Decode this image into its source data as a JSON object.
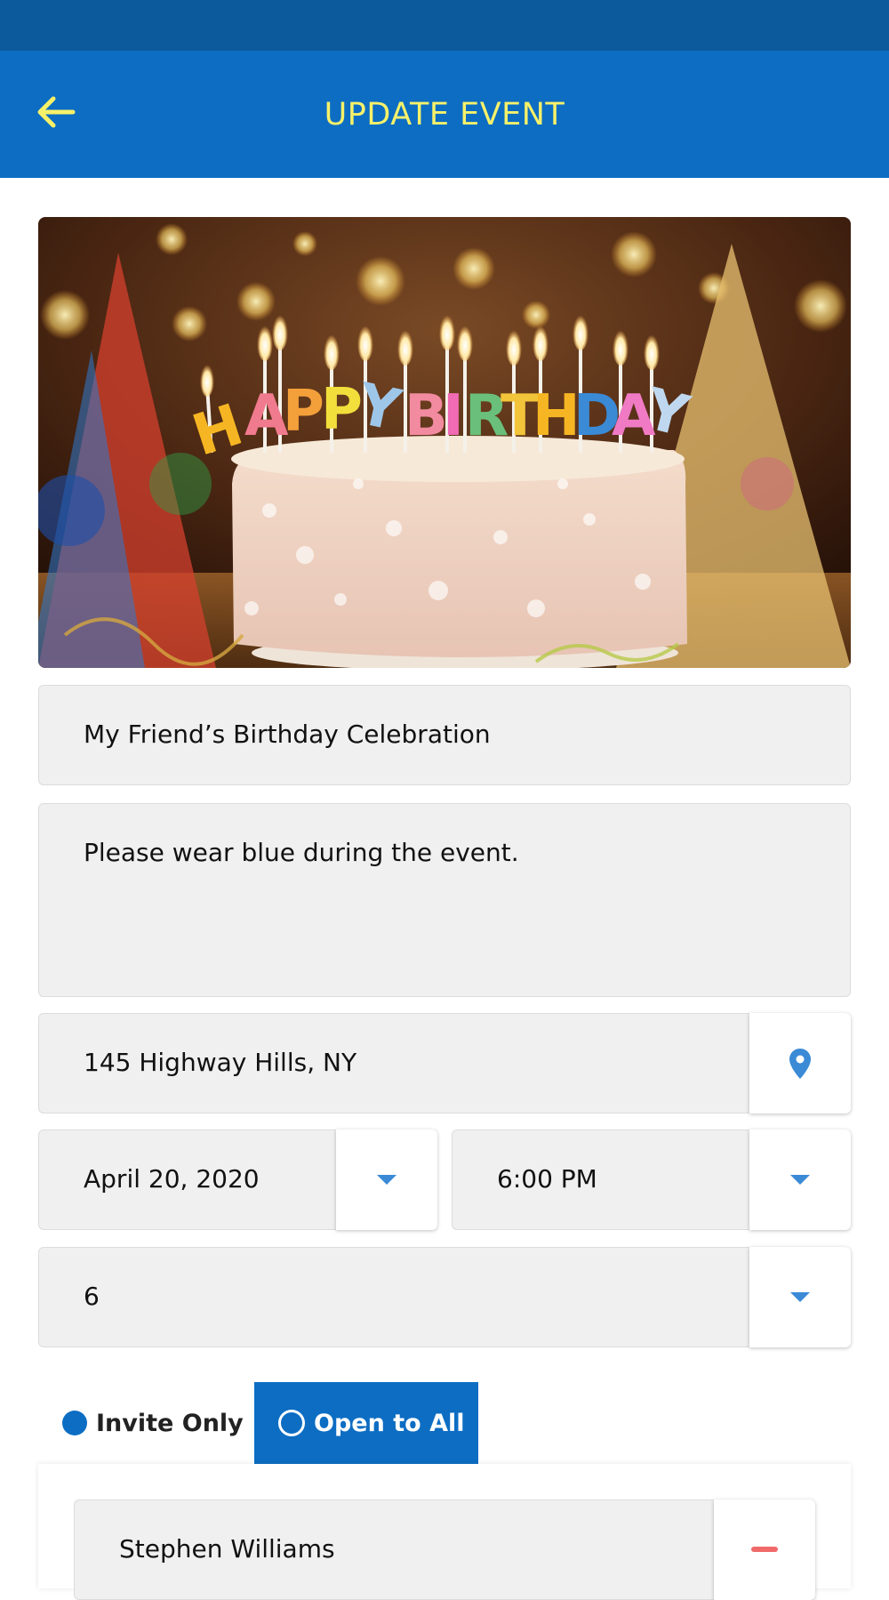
{
  "header": {
    "title": "UPDATE EVENT",
    "back_icon": "arrow-left-icon"
  },
  "hero_image": {
    "cake_lettering": "HAPPY BIRTHDAY"
  },
  "form": {
    "event_name": "My Friend’s Birthday Celebration",
    "description": "Please wear blue during the event.",
    "location": "145 Highway Hills, NY",
    "location_icon": "map-pin-icon",
    "date": "April 20, 2020",
    "time": "6:00 PM",
    "guest_count": "6",
    "dropdown_icon": "caret-down-icon"
  },
  "visibility": {
    "options": [
      "Invite Only",
      "Open to All"
    ],
    "selected": "Invite Only"
  },
  "invitees": [
    {
      "name": "Stephen Williams",
      "remove_icon": "minus-icon"
    }
  ],
  "colors": {
    "status_bar": "#0c5a9c",
    "app_bar": "#0c6dc3",
    "title": "#f7f16a",
    "accent": "#3a8ad6",
    "remove": "#f06a6a",
    "field_bg": "#f0f0f0"
  }
}
